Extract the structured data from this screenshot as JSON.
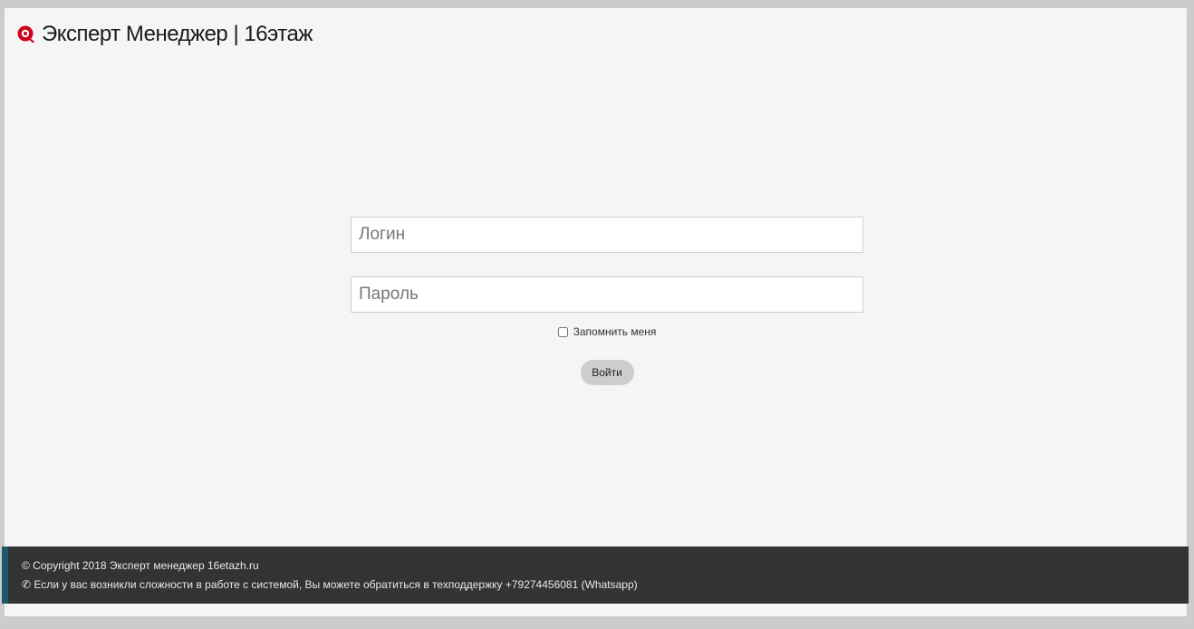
{
  "header": {
    "logo_icon": "brand-logo-icon",
    "title": "Эксперт Менеджер | 16этаж",
    "brand_color": "#d0021b"
  },
  "login": {
    "login_placeholder": "Логин",
    "password_placeholder": "Пароль",
    "remember_label": "Запомнить меня",
    "remember_checked": false,
    "submit_label": "Войти"
  },
  "footer": {
    "copyright": "© Copyright 2018 Эксперт менеджер 16etazh.ru",
    "support": "✆ Если у вас возникли сложности в работе с системой, Вы можете обратиться в техподдержку +79274456081 (Whatsapp)",
    "background": "#333333",
    "accent": "#1e5a6a"
  }
}
